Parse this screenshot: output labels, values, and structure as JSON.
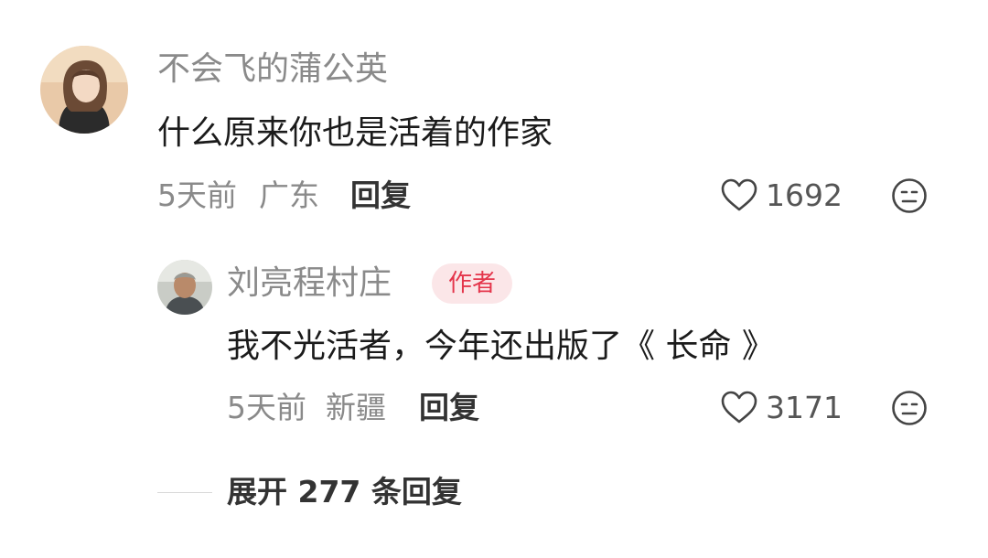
{
  "comment": {
    "username": "不会飞的蒲公英",
    "content": "什么原来你也是活着的作家",
    "time": "5天前",
    "location": "广东",
    "reply_label": "回复",
    "likes": "1692",
    "avatar_icon": "avatar-photo-woman",
    "like_icon": "heart-outline-icon",
    "dislike_icon": "unhappy-face-icon"
  },
  "reply": {
    "username": "刘亮程村庄",
    "badge": "作者",
    "content": "我不光活者，今年还出版了《 长命 》",
    "time": "5天前",
    "location": "新疆",
    "reply_label": "回复",
    "likes": "3171",
    "avatar_icon": "avatar-photo-man",
    "like_icon": "heart-outline-icon",
    "dislike_icon": "unhappy-face-icon"
  },
  "expand": {
    "label": "展开 277 条回复"
  },
  "colors": {
    "badge_bg": "#fbe6e8",
    "badge_text": "#e4354b",
    "meta_gray": "#8a8a8a"
  }
}
